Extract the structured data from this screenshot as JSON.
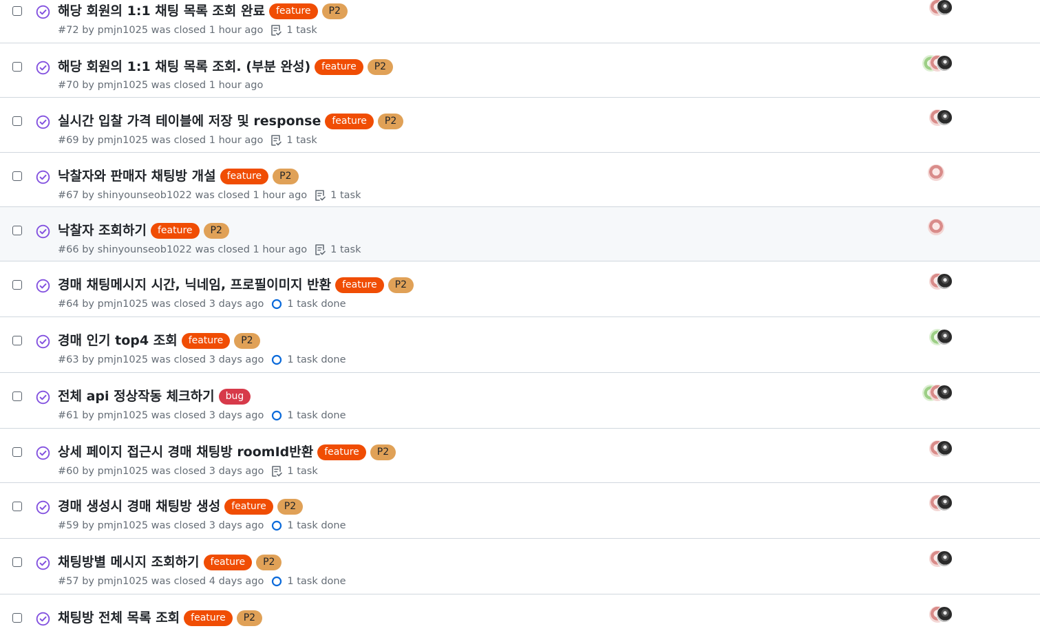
{
  "colors": {
    "feature": "#f04d04",
    "p2": "#e0a157",
    "bug": "#d73a4a",
    "closed_icon": "#8250df",
    "progress_ring": "#0969da"
  },
  "icons": {
    "status": "check-circle-icon",
    "checklist": "checklist-icon",
    "progress": "progress-ring-icon"
  },
  "issues": [
    {
      "title": "해당 회원의 1:1 채팅 목록 조회 완료",
      "labels": [
        {
          "text": "feature",
          "kind": "feature"
        },
        {
          "text": "P2",
          "kind": "p2"
        }
      ],
      "meta": "#72 by pmjn1025 was closed 1 hour ago",
      "task": "1 task",
      "task_icon": "checklist",
      "avatars": [
        "pink",
        "photo"
      ],
      "hover": false
    },
    {
      "title": "해당 회원의 1:1 채팅 목록 조회. (부분 완성)",
      "labels": [
        {
          "text": "feature",
          "kind": "feature"
        },
        {
          "text": "P2",
          "kind": "p2"
        }
      ],
      "meta": "#70 by pmjn1025 was closed 1 hour ago",
      "task": "",
      "task_icon": "",
      "avatars": [
        "green",
        "pink",
        "photo"
      ],
      "hover": false
    },
    {
      "title": "실시간 입찰 가격 테이블에 저장 및 response",
      "labels": [
        {
          "text": "feature",
          "kind": "feature"
        },
        {
          "text": "P2",
          "kind": "p2"
        }
      ],
      "meta": "#69 by pmjn1025 was closed 1 hour ago",
      "task": "1 task",
      "task_icon": "checklist",
      "avatars": [
        "pink",
        "photo"
      ],
      "hover": false
    },
    {
      "title": "낙찰자와 판매자 채팅방 개설",
      "labels": [
        {
          "text": "feature",
          "kind": "feature"
        },
        {
          "text": "P2",
          "kind": "p2"
        }
      ],
      "meta": "#67 by shinyounseob1022 was closed 1 hour ago",
      "task": "1 task",
      "task_icon": "checklist",
      "avatars": [
        "pink"
      ],
      "hover": false
    },
    {
      "title": "낙찰자 조회하기",
      "labels": [
        {
          "text": "feature",
          "kind": "feature"
        },
        {
          "text": "P2",
          "kind": "p2"
        }
      ],
      "meta": "#66 by shinyounseob1022 was closed 1 hour ago",
      "task": "1 task",
      "task_icon": "checklist",
      "avatars": [
        "pink"
      ],
      "hover": true
    },
    {
      "title": "경매 채팅메시지 시간, 닉네임, 프로필이미지 반환",
      "labels": [
        {
          "text": "feature",
          "kind": "feature"
        },
        {
          "text": "P2",
          "kind": "p2"
        }
      ],
      "meta": "#64 by pmjn1025 was closed 3 days ago",
      "task": "1 task done",
      "task_icon": "progress",
      "avatars": [
        "pink",
        "photo"
      ],
      "hover": false
    },
    {
      "title": "경매 인기 top4 조회",
      "labels": [
        {
          "text": "feature",
          "kind": "feature"
        },
        {
          "text": "P2",
          "kind": "p2"
        }
      ],
      "meta": "#63 by pmjn1025 was closed 3 days ago",
      "task": "1 task done",
      "task_icon": "progress",
      "avatars": [
        "green",
        "photo"
      ],
      "hover": false
    },
    {
      "title": "전체 api 정상작동 체크하기",
      "labels": [
        {
          "text": "bug",
          "kind": "bug"
        }
      ],
      "meta": "#61 by pmjn1025 was closed 3 days ago",
      "task": "1 task done",
      "task_icon": "progress",
      "avatars": [
        "green",
        "pink",
        "photo"
      ],
      "hover": false
    },
    {
      "title": "상세 페이지 접근시 경매 채팅방 roomId반환",
      "labels": [
        {
          "text": "feature",
          "kind": "feature"
        },
        {
          "text": "P2",
          "kind": "p2"
        }
      ],
      "meta": "#60 by pmjn1025 was closed 3 days ago",
      "task": "1 task",
      "task_icon": "checklist",
      "avatars": [
        "pink",
        "photo"
      ],
      "hover": false
    },
    {
      "title": "경매 생성시 경매 채팅방 생성",
      "labels": [
        {
          "text": "feature",
          "kind": "feature"
        },
        {
          "text": "P2",
          "kind": "p2"
        }
      ],
      "meta": "#59 by pmjn1025 was closed 3 days ago",
      "task": "1 task done",
      "task_icon": "progress",
      "avatars": [
        "pink",
        "photo"
      ],
      "hover": false
    },
    {
      "title": "채팅방별 메시지 조회하기",
      "labels": [
        {
          "text": "feature",
          "kind": "feature"
        },
        {
          "text": "P2",
          "kind": "p2"
        }
      ],
      "meta": "#57 by pmjn1025 was closed 4 days ago",
      "task": "1 task done",
      "task_icon": "progress",
      "avatars": [
        "pink",
        "photo"
      ],
      "hover": false
    },
    {
      "title": "채팅방 전체 목록 조회",
      "labels": [
        {
          "text": "feature",
          "kind": "feature"
        },
        {
          "text": "P2",
          "kind": "p2"
        }
      ],
      "meta": "",
      "task": "",
      "task_icon": "",
      "avatars": [
        "pink",
        "photo"
      ],
      "hover": false
    }
  ]
}
